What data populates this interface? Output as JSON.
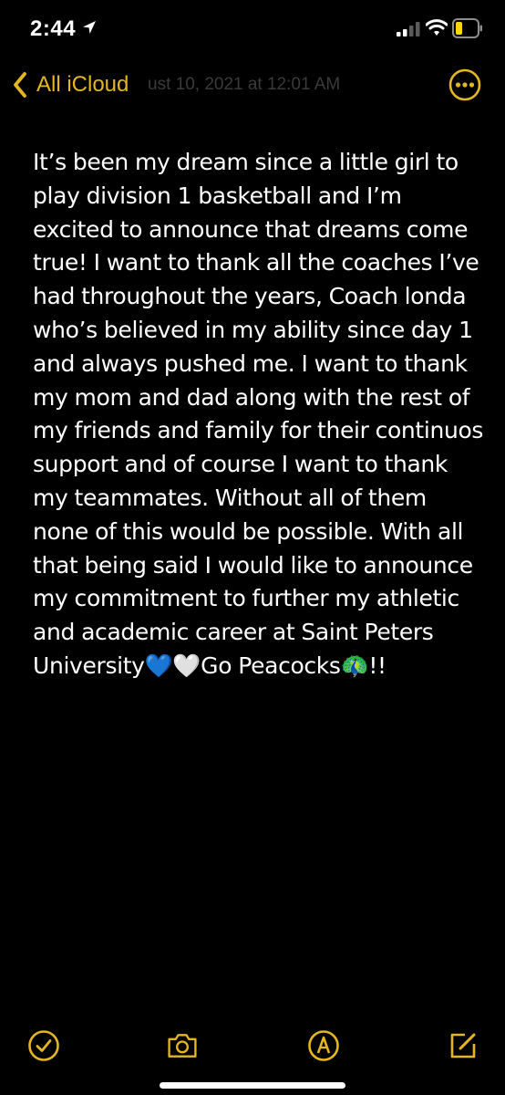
{
  "status_bar": {
    "time": "2:44"
  },
  "nav": {
    "back_label": "All iCloud",
    "ghost_title": "ust 10, 2021 at 12:01 AM"
  },
  "note": {
    "text": "It’s been my dream since a little girl to play division 1 basketball and I’m excited to announce that dreams come true! I want to thank all the coaches I’ve had throughout the years, Coach londa who’s believed in my ability since day 1 and always pushed me. I want to thank my mom and dad along with the rest of my friends and family for their continuos support and of course I want to thank my teammates. Without all of them none of this would be possible. With all that being said I would like to announce my commitment to further my athletic and academic career at Saint Peters University💙🤍Go Peacocks🦚!!"
  },
  "toolbar": {
    "icons": [
      "checklist-icon",
      "camera-icon",
      "markup-icon",
      "compose-icon"
    ]
  },
  "colors": {
    "accent": "#e3b622",
    "background": "#000000",
    "text": "#ffffff",
    "battery": "#ffd60a"
  }
}
